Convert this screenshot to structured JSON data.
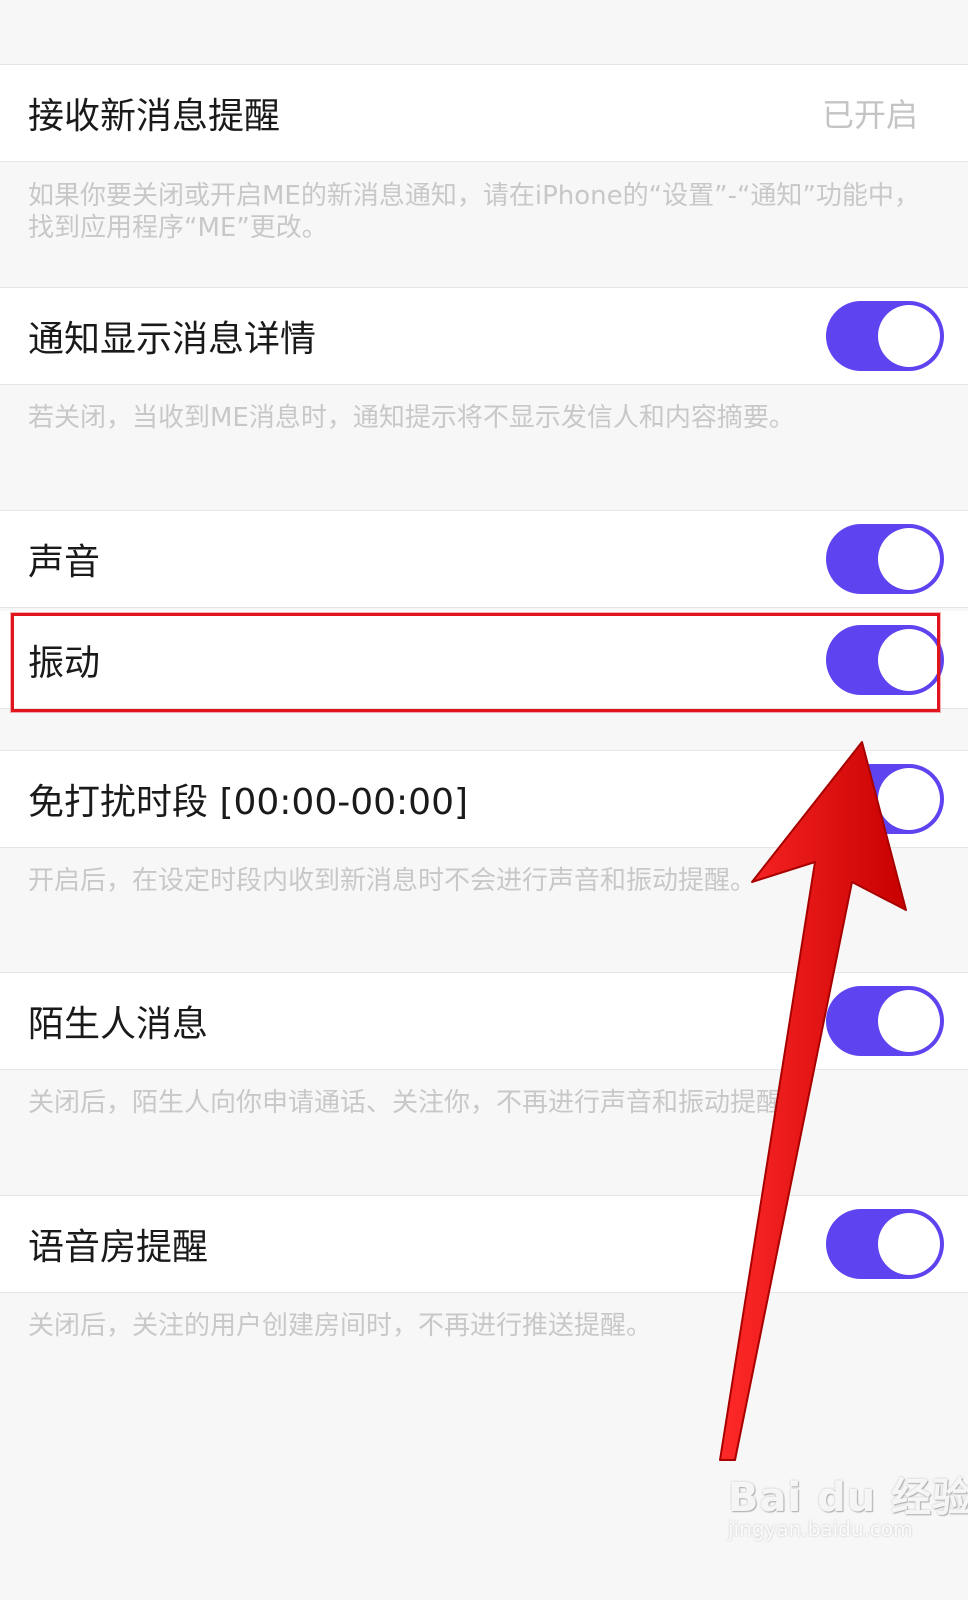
{
  "settings": {
    "new_message": {
      "label": "接收新消息提醒",
      "status": "已开启",
      "hint": "如果你要关闭或开启ME的新消息通知，请在iPhone的“设置”-“通知”功能中，找到应用程序“ME”更改。"
    },
    "show_details": {
      "label": "通知显示消息详情",
      "enabled": true,
      "hint": "若关闭，当收到ME消息时，通知提示将不显示发信人和内容摘要。"
    },
    "sound": {
      "label": "声音",
      "enabled": true
    },
    "vibration": {
      "label": "振动",
      "enabled": true
    },
    "dnd": {
      "label": "免打扰时段 [00:00-00:00]",
      "enabled": false,
      "hint": "开启后，在设定时段内收到新消息时不会进行声音和振动提醒。"
    },
    "stranger": {
      "label": "陌生人消息",
      "enabled": true,
      "hint": "关闭后，陌生人向你申请通话、关注你，不再进行声音和振动提醒。"
    },
    "voice_room": {
      "label": "语音房提醒",
      "enabled": true,
      "hint": "关闭后，关注的用户创建房间时，不再进行推送提醒。"
    }
  },
  "colors": {
    "accent": "#5e44f0",
    "annotation": "#e0141d"
  },
  "watermark": {
    "brand": "Bai du 经验",
    "url": "jingyan.baidu.com"
  }
}
